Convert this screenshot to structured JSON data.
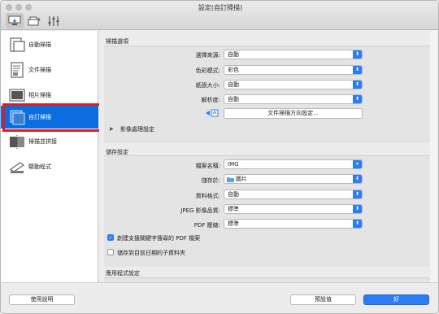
{
  "window": {
    "title": "設定(自訂掃描)"
  },
  "toolbar": {
    "tabs": [
      {
        "icon": "scan-from-computer-icon"
      },
      {
        "icon": "scan-from-operation-panel-icon"
      },
      {
        "icon": "general-settings-icon"
      }
    ]
  },
  "sidebar": {
    "items": [
      {
        "label": "自動掃描",
        "icon": "auto-scan-icon"
      },
      {
        "label": "文件掃描",
        "icon": "document-scan-icon"
      },
      {
        "label": "相片掃描",
        "icon": "photo-scan-icon"
      },
      {
        "label": "自訂掃描",
        "icon": "custom-scan-icon",
        "selected": true
      },
      {
        "label": "掃描並拼接",
        "icon": "scan-stitch-icon"
      },
      {
        "label": "驅動程式",
        "icon": "driver-icon"
      }
    ]
  },
  "scan_options": {
    "title": "掃描選項",
    "source_label": "選擇來源:",
    "source_value": "自動",
    "color_label": "色彩模式:",
    "color_value": "彩色",
    "paper_label": "紙張大小:",
    "paper_value": "自動",
    "resolution_label": "解析度:",
    "resolution_value": "自動",
    "orientation_button": "文件掃描方向設定...",
    "image_processing": "影像處理設定"
  },
  "save_settings": {
    "title": "儲存設定",
    "filename_label": "檔案名稱:",
    "filename_value": "IMG",
    "save_in_label": "儲存於:",
    "save_in_value": "圖片",
    "format_label": "資料格式:",
    "format_value": "自動",
    "jpeg_label": "JPEG 影像品質:",
    "jpeg_value": "標準",
    "pdf_label": "PDF 壓縮:",
    "pdf_value": "標準",
    "keyword_pdf_label": "創建支援關鍵字搜尋的 PDF 檔案",
    "keyword_pdf_checked": true,
    "subfolder_label": "儲存到目前日期的子資料夾",
    "subfolder_checked": false
  },
  "app_settings": {
    "title": "應用程式設定"
  },
  "footer": {
    "help_label": "使用說明",
    "defaults_label": "預設值",
    "ok_label": "好"
  }
}
